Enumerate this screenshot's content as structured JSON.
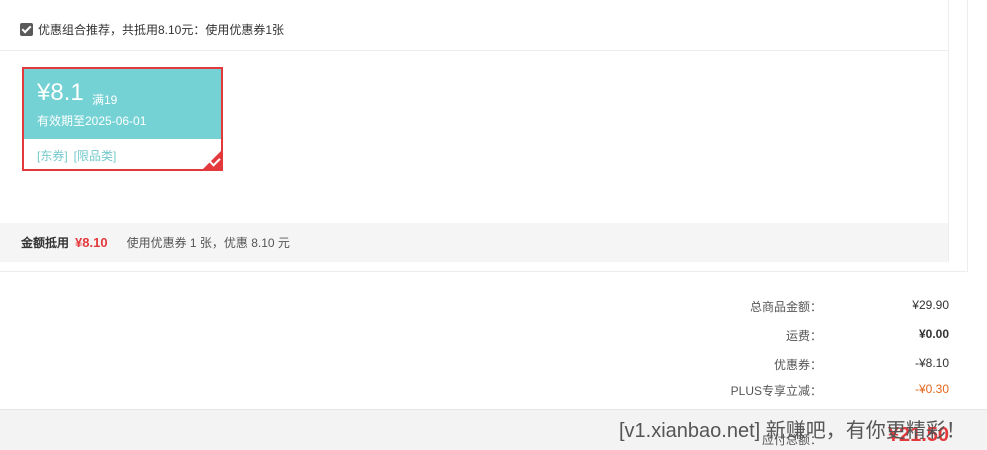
{
  "recommend": {
    "checked": true,
    "text": "优惠组合推荐，共抵用8.10元：使用优惠券1张"
  },
  "coupon": {
    "amount": "¥8.1",
    "condition": "满19",
    "expire": "有效期至2025-06-01",
    "tags": [
      "[东券]",
      "[限品类]"
    ],
    "selected": true
  },
  "summary": {
    "label": "金额抵用",
    "amount": "¥8.10",
    "description": "使用优惠券 1 张，优惠 8.10 元"
  },
  "totals": [
    {
      "label": "总商品金额：",
      "value": "¥29.90"
    },
    {
      "label": "运费：",
      "value": "¥0.00"
    },
    {
      "label": "优惠券：",
      "value": "-¥8.10"
    },
    {
      "label": "PLUS专享立减：",
      "value": "-¥0.30"
    }
  ],
  "payable": {
    "label": "应付总额：",
    "value": "¥21.50"
  },
  "watermark": "[v1.xianbao.net] 新赚吧，有你更精彩！",
  "colors": {
    "accent_red": "#e4393c",
    "coupon_teal": "#74d2d4",
    "plus_orange": "#e4661b"
  }
}
